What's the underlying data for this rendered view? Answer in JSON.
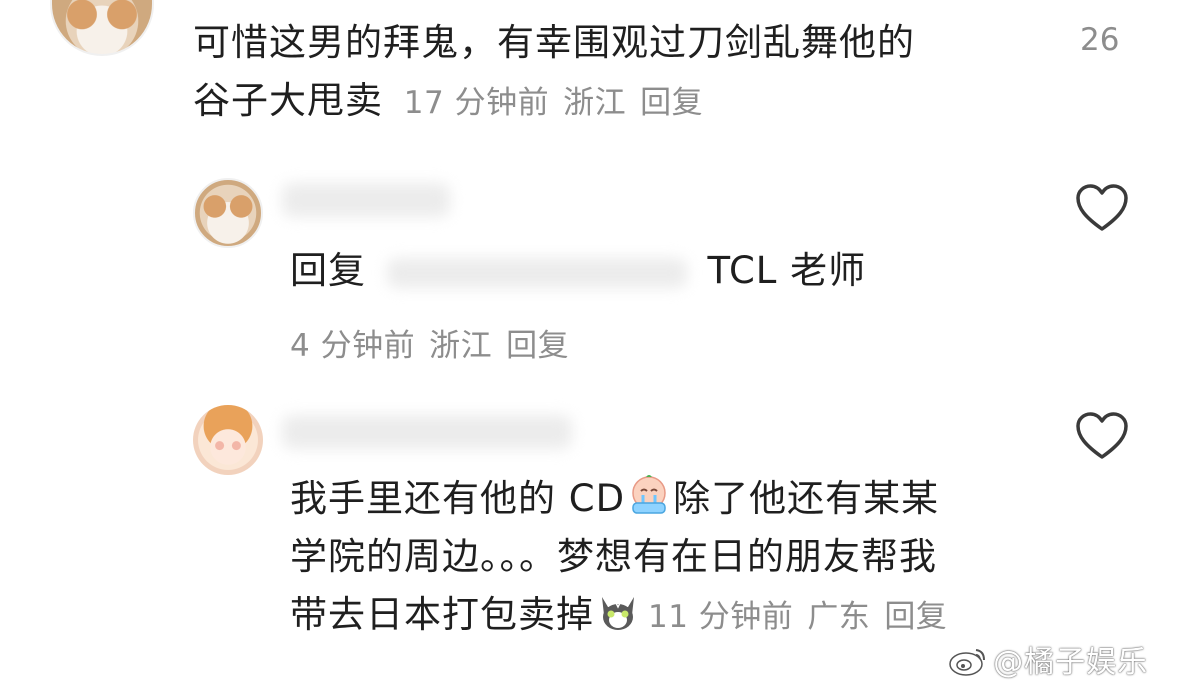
{
  "comments": [
    {
      "id": "c1",
      "text_line1": "可惜这男的拜鬼，有幸围观过刀剑乱舞他的",
      "text_line2": "谷子大甩卖",
      "time": "17 分钟前",
      "location": "浙江",
      "reply_label": "回复",
      "like_count": "26"
    },
    {
      "id": "c2",
      "reply_prefix": "回复",
      "text_suffix": "TCL 老师",
      "time": "4 分钟前",
      "location": "浙江",
      "reply_label": "回复"
    },
    {
      "id": "c3",
      "text_line1_a": "我手里还有他的 CD",
      "text_line1_b": "除了他还有某某",
      "text_line2": "学院的周边。。。梦想有在日的朋友帮我",
      "text_line3": "带去日本打包卖掉",
      "time": "11 分钟前",
      "location": "广东",
      "reply_label": "回复"
    }
  ],
  "icons": {
    "heart": "heart-outline-icon",
    "crying_emoji": "crying-face-emoji",
    "cat_emoji": "cat-face-emoji",
    "weibo": "weibo-logo-icon"
  },
  "watermark": {
    "text": "@橘子娱乐"
  },
  "colors": {
    "text": "#1f1f1f",
    "meta": "#8d8d8d",
    "heart": "#3a3a3a",
    "background": "#ffffff"
  }
}
